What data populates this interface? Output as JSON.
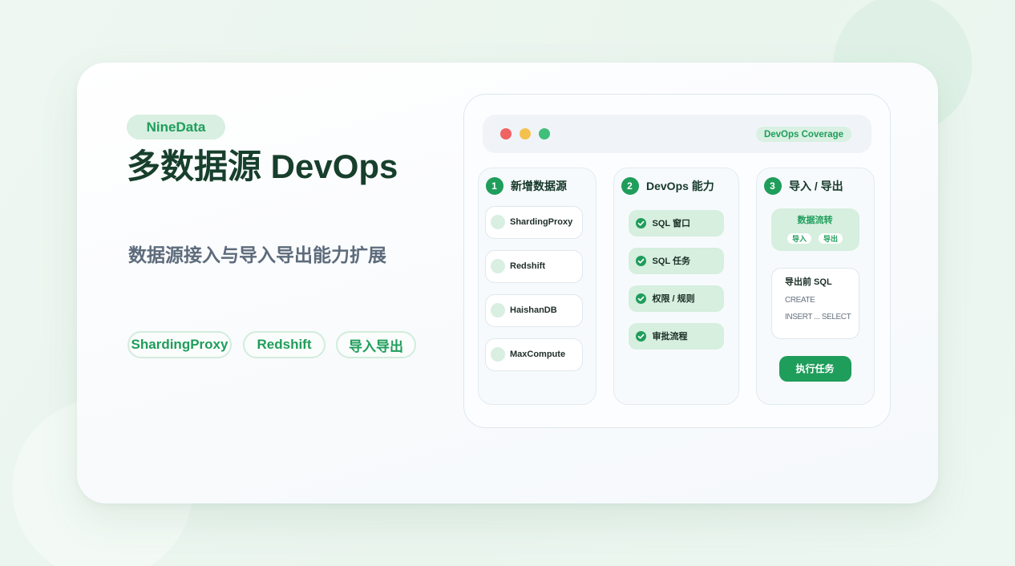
{
  "brand": {
    "name": "NineData"
  },
  "hero": {
    "title": "多数据源 DevOps",
    "subtitle": "数据源接入与导入导出能力扩展",
    "tags": [
      "ShardingProxy",
      "Redshift",
      "导入导出"
    ]
  },
  "window": {
    "dots": [
      "#ef6361",
      "#f5c14e",
      "#3fbf79"
    ],
    "badge": "DevOps Coverage"
  },
  "columns": [
    {
      "number": "1",
      "title": "新增数据源",
      "items": [
        "ShardingProxy",
        "Redshift",
        "HaishanDB",
        "MaxCompute"
      ]
    },
    {
      "number": "2",
      "title": "DevOps 能力",
      "item_icon": "check-circle-icon",
      "items": [
        "SQL 窗口",
        "SQL 任务",
        "权限 / 规则",
        "审批流程"
      ]
    },
    {
      "number": "3",
      "title": "导入 / 导出",
      "flow": {
        "title": "数据流转",
        "chips": [
          "导入",
          "导出"
        ]
      },
      "sql_card": {
        "title": "导出前 SQL",
        "lines": [
          "CREATE",
          "INSERT ... SELECT"
        ]
      },
      "action_label": "执行任务"
    }
  ],
  "colors": {
    "accent": "#1f9d5b",
    "accent_soft": "#d7efe0",
    "heading": "#173f2c",
    "subtitle": "#5d6b7b"
  }
}
